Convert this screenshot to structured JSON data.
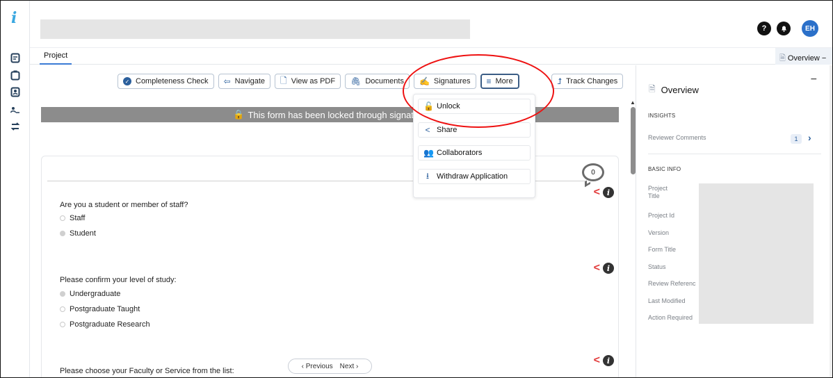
{
  "rail": {
    "logo": "i",
    "items": [
      "document",
      "clipboard",
      "person-card",
      "people",
      "swap"
    ]
  },
  "header": {
    "help": "?",
    "bell": "🔔",
    "avatar": "EH"
  },
  "tabs": {
    "project": "Project",
    "overview": "Overview −"
  },
  "toolbar": {
    "completeness": "Completeness Check",
    "navigate": "Navigate",
    "view_pdf": "View as PDF",
    "documents": "Documents",
    "signatures": "Signatures",
    "more": "More",
    "track_changes": "Track Changes"
  },
  "banner": {
    "text": "This form has been locked through signature"
  },
  "more_menu": {
    "items": [
      {
        "label": "Unlock",
        "icon": "unlock-icon"
      },
      {
        "label": "Share",
        "icon": "share-icon"
      },
      {
        "label": "Collaborators",
        "icon": "collaborators-icon"
      },
      {
        "label": "Withdraw Application",
        "icon": "withdraw-icon"
      }
    ]
  },
  "form": {
    "comment_count": "0",
    "q1": {
      "label": "Are you a student or member of staff?",
      "options": [
        "Staff",
        "Student"
      ],
      "selected": "Student"
    },
    "q2": {
      "label": "Please confirm your level of study:",
      "options": [
        "Undergraduate",
        "Postgraduate Taught",
        "Postgraduate Research"
      ],
      "selected": "Undergraduate"
    },
    "q3": {
      "label": "Please choose your Faculty or Service from the list:"
    }
  },
  "pager": {
    "previous": "‹ Previous",
    "next": "Next ›"
  },
  "overview": {
    "title": "Overview",
    "minimize": "−",
    "insights": "INSIGHTS",
    "reviewer_comments": "Reviewer Comments",
    "reviewer_count": "1",
    "basic_info": "BASIC INFO",
    "project_title": "Project\nTitle",
    "project_id": "Project Id",
    "version": "Version",
    "form_title": "Form Title",
    "status": "Status",
    "review_reference": "Review Referenc",
    "last_modified": "Last Modified",
    "action_required": "Action Required"
  },
  "colors": {
    "accent": "#2b5f9c",
    "highlight": "#e11111",
    "banner": "#8c8c8c",
    "share": "#e23a3a"
  }
}
